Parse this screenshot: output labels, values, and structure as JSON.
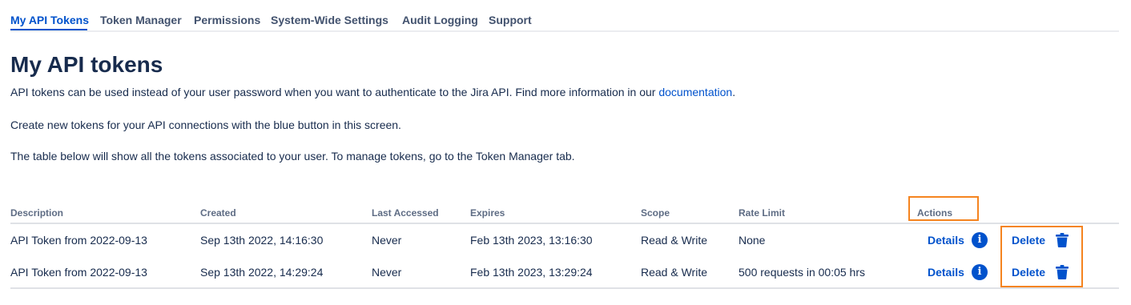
{
  "tabs": [
    {
      "label": "My API Tokens",
      "active": true
    },
    {
      "label": "Token Manager",
      "active": false
    },
    {
      "label": "Permissions",
      "active": false
    },
    {
      "label": "System-Wide Settings",
      "active": false
    },
    {
      "label": "Audit Logging",
      "active": false
    },
    {
      "label": "Support",
      "active": false
    }
  ],
  "page": {
    "title": "My API tokens",
    "intro_before_link": "API tokens can be used instead of your user password when you want to authenticate to the Jira API. Find more information in our ",
    "intro_link": "documentation",
    "intro_after_link": ".",
    "create_text": "Create new tokens for your API connections with the blue button in this screen.",
    "table_text": "The table below will show all the tokens associated to your user. To manage tokens, go to the Token Manager tab."
  },
  "table": {
    "headers": {
      "description": "Description",
      "created": "Created",
      "last_accessed": "Last Accessed",
      "expires": "Expires",
      "scope": "Scope",
      "rate_limit": "Rate Limit",
      "actions": "Actions"
    },
    "rows": [
      {
        "description": "API Token from 2022-09-13",
        "created": "Sep 13th 2022, 14:16:30",
        "last_accessed": "Never",
        "expires": "Feb 13th 2023, 13:16:30",
        "scope": "Read & Write",
        "rate_limit": "None",
        "details_label": "Details",
        "delete_label": "Delete"
      },
      {
        "description": "API Token from 2022-09-13",
        "created": "Sep 13th 2022, 14:29:24",
        "last_accessed": "Never",
        "expires": "Feb 13th 2023, 13:29:24",
        "scope": "Read & Write",
        "rate_limit": "500 requests in 00:05 hrs",
        "details_label": "Details",
        "delete_label": "Delete"
      }
    ]
  },
  "icons": {
    "info": "info-icon",
    "delete": "trash-icon"
  },
  "colors": {
    "accent": "#0052cc",
    "text": "#172b4d",
    "muted": "#5e6c84",
    "highlight": "#f5841f",
    "divider": "#dfe1e6"
  }
}
